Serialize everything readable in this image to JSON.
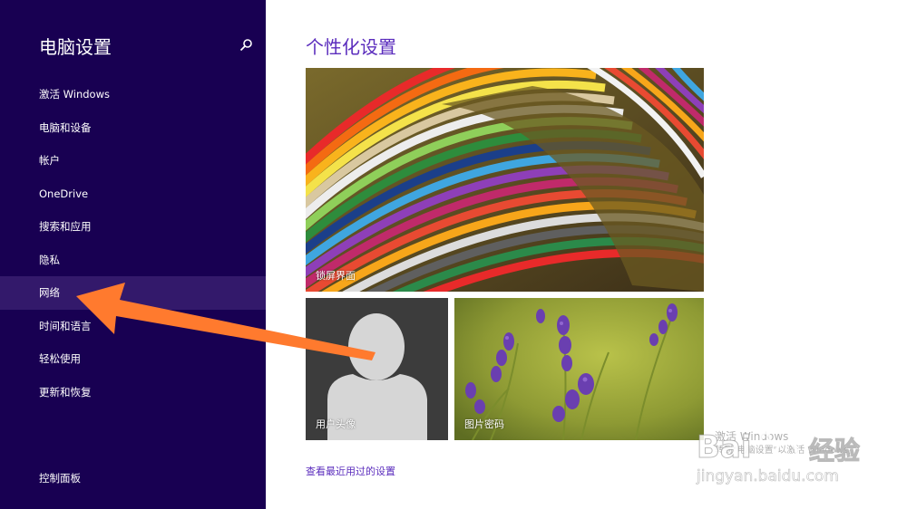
{
  "sidebar": {
    "title": "电脑设置",
    "items": [
      {
        "label": "激活 Windows"
      },
      {
        "label": "电脑和设备"
      },
      {
        "label": "帐户"
      },
      {
        "label": "OneDrive"
      },
      {
        "label": "搜索和应用"
      },
      {
        "label": "隐私"
      },
      {
        "label": "网络",
        "selected": true
      },
      {
        "label": "时间和语言"
      },
      {
        "label": "轻松使用"
      },
      {
        "label": "更新和恢复"
      }
    ],
    "control_panel": "控制面板"
  },
  "main": {
    "title": "个性化设置",
    "tiles": {
      "lock_screen": "锁屏界面",
      "account_picture": "用户头像",
      "picture_password": "图片密码"
    },
    "recent_link": "查看最近用过的设置"
  },
  "overlay": {
    "activation_text_1": "激活 Windows",
    "activation_text_2": "转到\"电脑设置\"以激活 Windows。",
    "watermark_brand": "Bai",
    "watermark_site": "jingyan.baidu.com",
    "watermark_cn": "经验"
  },
  "colors": {
    "sidebar_bg": "#180052",
    "sidebar_selected": "#33196b",
    "accent": "#5b2dbd",
    "arrow": "#ff7a2e"
  }
}
